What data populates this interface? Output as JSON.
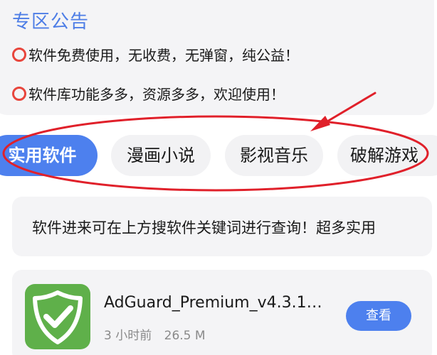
{
  "notice": {
    "title": "专区公告",
    "lines": [
      "软件免费使用，无收费，无弹窗，纯公益！",
      "软件库功能多多，资源多多，欢迎使用！"
    ]
  },
  "tabs": [
    {
      "label": "实用软件",
      "active": true
    },
    {
      "label": "漫画小说",
      "active": false
    },
    {
      "label": "影视音乐",
      "active": false
    },
    {
      "label": "破解游戏",
      "active": false
    }
  ],
  "search_tip": {
    "text": "软件进来可在上方搜软件关键词进行查询！超多实用"
  },
  "apps": [
    {
      "name": "AdGuard_Premium_v4.3.1…",
      "time": "3 小时前",
      "size": "26.5 M",
      "button": "查看"
    }
  ],
  "colors": {
    "accent": "#4d80ee",
    "annotation_red": "#e0202a",
    "card_bg": "#f4f4f6"
  }
}
